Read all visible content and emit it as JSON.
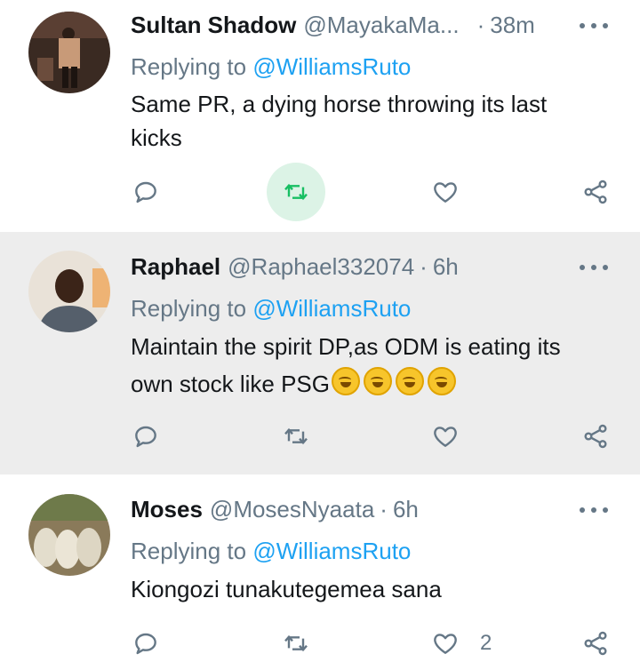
{
  "tweets": [
    {
      "name": "Sultan Shadow",
      "handle": "@MayakaMa...",
      "time": "38m",
      "replying_prefix": "Replying to ",
      "mention": "@WilliamsRuto",
      "text_lines": [
        "Same PR,  a dying horse throwing its last",
        "kicks"
      ],
      "retweet_active": true
    },
    {
      "name": "Raphael",
      "handle": "@Raphael332074",
      "time": "6h",
      "replying_prefix": "Replying to ",
      "mention": "@WilliamsRuto",
      "text_lines": [
        "Maintain the spirit DP,as ODM is eating its",
        "own stock like PSG"
      ],
      "emoji_count": 4,
      "emoji_name": "rolling-on-floor-laughing"
    },
    {
      "name": "Moses",
      "handle": "@MosesNyaata",
      "time": "6h",
      "replying_prefix": "Replying to ",
      "mention": "@WilliamsRuto",
      "text_lines": [
        "Kiongozi tunakutegemea sana"
      ],
      "like_count": "2"
    }
  ],
  "dot_separator": "·",
  "icons": {
    "reply": "reply-icon",
    "retweet": "retweet-icon",
    "like": "heart-icon",
    "share": "share-icon",
    "more": "more-icon"
  },
  "colors": {
    "text": "#14171a",
    "muted": "#657786",
    "mention": "#1da1f2",
    "retweet_active": "#17bf63",
    "highlight_bg": "#ededed"
  }
}
